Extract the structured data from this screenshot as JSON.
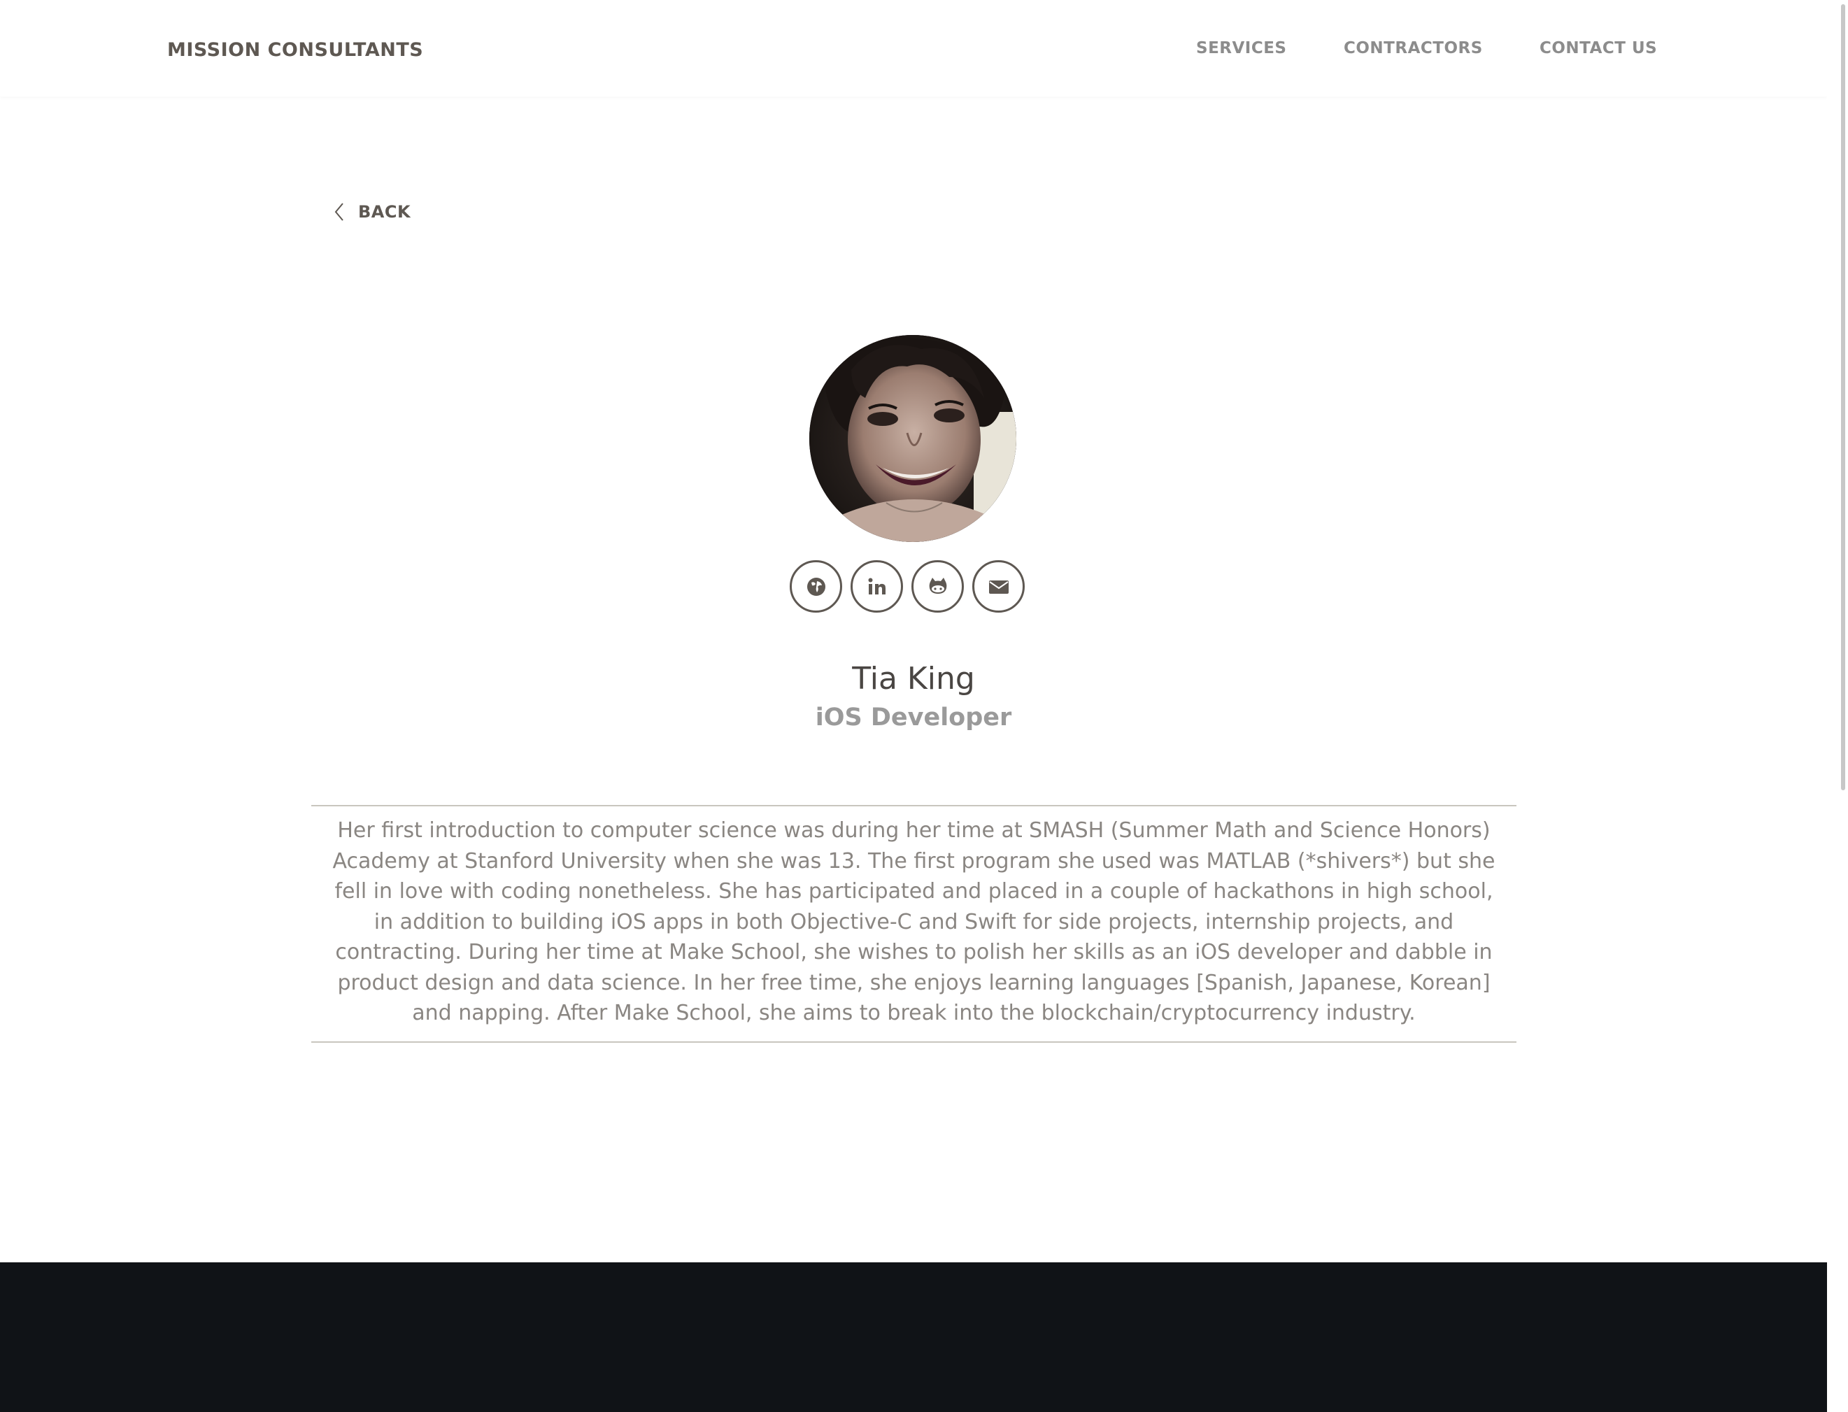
{
  "header": {
    "brand": "MISSION CONSULTANTS",
    "nav": [
      "SERVICES",
      "CONTRACTORS",
      "CONTACT US"
    ]
  },
  "back": {
    "label": "BACK",
    "icon": "chevron-left-icon"
  },
  "profile": {
    "name": "Tia King",
    "role": "iOS Developer",
    "socials": [
      {
        "icon": "globe-icon",
        "label": "website"
      },
      {
        "icon": "linkedin-icon",
        "label": "LinkedIn"
      },
      {
        "icon": "github-icon",
        "label": "GitHub"
      },
      {
        "icon": "envelope-icon",
        "label": "email"
      }
    ],
    "bio": "Her first introduction to computer science was during her time at SMASH (Summer Math and Science Honors) Academy at Stanford University when she was 13. The first program she used was MATLAB (*shivers*) but she fell in love with coding nonetheless. She has participated and placed in a couple of hackathons in high school, in addition to building iOS apps in both Objective-C and Swift for side projects, internship projects, and contracting. During her time at Make School, she wishes to polish her skills as an iOS developer and dabble in product design and data science. In her free time, she enjoys learning languages [Spanish, Japanese, Korean] and napping. After Make School, she aims to break into the blockchain/cryptocurrency industry."
  },
  "colors": {
    "text_dark": "#5e5852",
    "nav_gray": "#8c8c8c",
    "role_gray": "#9a9a9a",
    "bio_gray": "#8a8682",
    "footer_bg": "#101317"
  }
}
